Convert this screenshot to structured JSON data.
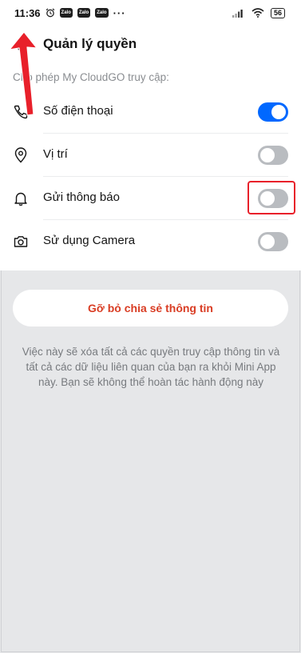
{
  "statusbar": {
    "time": "11:36",
    "apps": [
      "Zalo",
      "Zalo",
      "Zalo"
    ],
    "more": "···",
    "battery": "56"
  },
  "header": {
    "title": "Quản lý quyền",
    "back_icon": "chevron-left-icon"
  },
  "permissions": {
    "label": "Cho phép My CloudGO truy cập:",
    "items": [
      {
        "label": "Số điện thoại",
        "icon": "phone-icon",
        "enabled": true
      },
      {
        "label": "Vị trí",
        "icon": "location-pin-icon",
        "enabled": false
      },
      {
        "label": "Gửi thông báo",
        "icon": "bell-icon",
        "enabled": false
      },
      {
        "label": "Sử dụng Camera",
        "icon": "camera-icon",
        "enabled": false
      }
    ]
  },
  "actions": {
    "remove_label": "Gỡ bỏ chia sẻ thông tin",
    "note": "Việc này sẽ xóa tất cả các quyền truy cập thông tin và tất cả các dữ liệu liên quan của bạn ra khỏi Mini App này. Bạn sẽ không thể hoàn tác hành động này"
  },
  "colors": {
    "accent": "#0068ff",
    "toggle_off": "#b9bcc0",
    "danger_text": "#d93c23",
    "annotation": "#e8202a",
    "background": "#e6e7e9"
  }
}
